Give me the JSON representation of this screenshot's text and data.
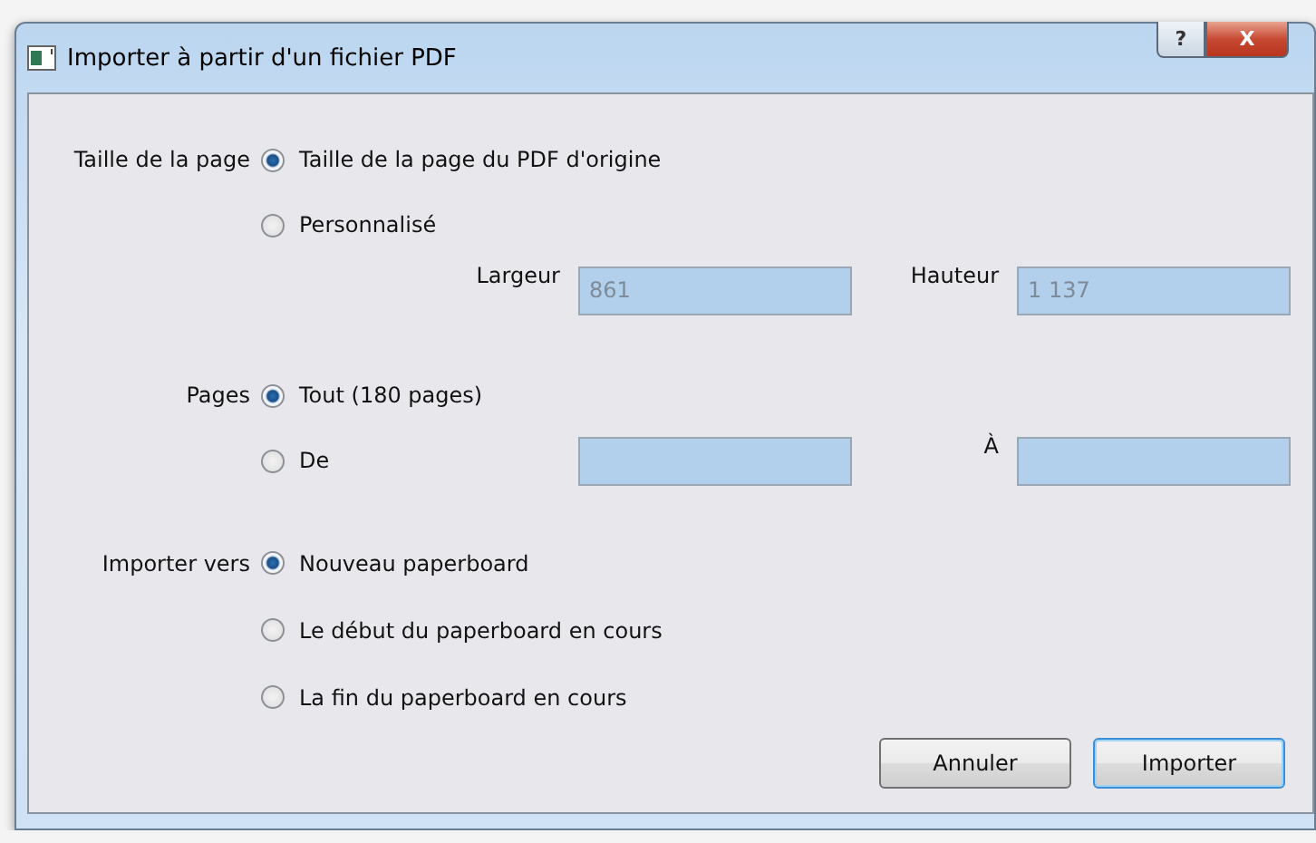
{
  "window": {
    "title": "Importer à partir d'un fichier PDF",
    "help_button": "?",
    "close_button": "X"
  },
  "page_size": {
    "label": "Taille de la page",
    "options": [
      {
        "label": "Taille de la page du PDF d'origine",
        "selected": true
      },
      {
        "label": "Personnalisé",
        "selected": false
      }
    ],
    "fields": [
      {
        "label": "Largeur",
        "value": "861"
      },
      {
        "label": "Hauteur",
        "value": "1 137"
      }
    ]
  },
  "pages": {
    "label": "Pages",
    "options": [
      {
        "label": "Tout (180 pages)",
        "selected": true
      },
      {
        "label": "De",
        "selected": false
      }
    ],
    "to_label": "À"
  },
  "import_to": {
    "label": "Importer vers",
    "options": [
      {
        "label": "Nouveau paperboard",
        "selected": true
      },
      {
        "label": "Le début du paperboard en cours",
        "selected": false
      },
      {
        "label": "La fin du paperboard en cours",
        "selected": false
      }
    ]
  },
  "buttons": [
    {
      "label": "Annuler",
      "default": false
    },
    {
      "label": "Importer",
      "default": true
    }
  ]
}
